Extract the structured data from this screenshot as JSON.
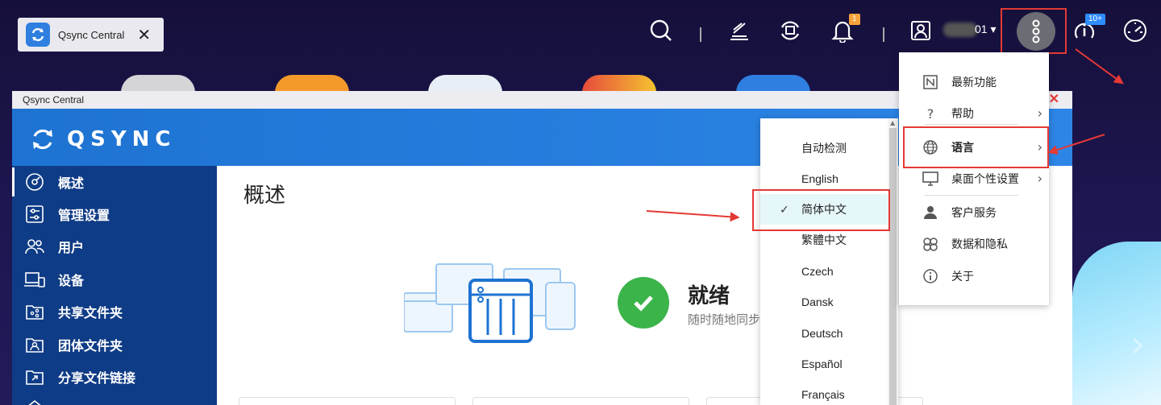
{
  "taskbar": {
    "tab_label": "Qsync Central"
  },
  "topbar": {
    "notification_count": "1",
    "user_label": "01 ▾",
    "info_badge": "10+"
  },
  "window": {
    "title": "Qsync Central",
    "logo_text": "QSYNC"
  },
  "sidebar": {
    "items": [
      {
        "label": "概述",
        "icon": "overview-icon"
      },
      {
        "label": "管理设置",
        "icon": "settings-sliders-icon"
      },
      {
        "label": "用户",
        "icon": "users-icon"
      },
      {
        "label": "设备",
        "icon": "devices-icon"
      },
      {
        "label": "共享文件夹",
        "icon": "shared-folder-icon"
      },
      {
        "label": "团体文件夹",
        "icon": "team-folder-icon"
      },
      {
        "label": "分享文件链接",
        "icon": "share-link-icon"
      }
    ]
  },
  "main": {
    "title": "概述",
    "status_title": "就绪",
    "status_sub": "随时随地同步"
  },
  "main_menu": {
    "items": [
      {
        "label": "最新功能",
        "icon": "whats-new-icon"
      },
      {
        "label": "帮助",
        "icon": "help-icon"
      },
      {
        "label": "语言",
        "icon": "globe-icon"
      },
      {
        "label": "桌面个性设置",
        "icon": "monitor-icon"
      },
      {
        "label": "客户服务",
        "icon": "person-icon"
      },
      {
        "label": "数据和隐私",
        "icon": "privacy-icon"
      },
      {
        "label": "关于",
        "icon": "info-icon"
      }
    ]
  },
  "language_menu": {
    "selected": "简体中文",
    "items": [
      "自动检测",
      "English",
      "简体中文",
      "繁體中文",
      "Czech",
      "Dansk",
      "Deutsch",
      "Español",
      "Français"
    ]
  },
  "colors": {
    "accent_blue": "#1e73d2",
    "sidebar": "#0f3c86",
    "annotation_red": "#e53935",
    "ready_green": "#3bb44a"
  }
}
